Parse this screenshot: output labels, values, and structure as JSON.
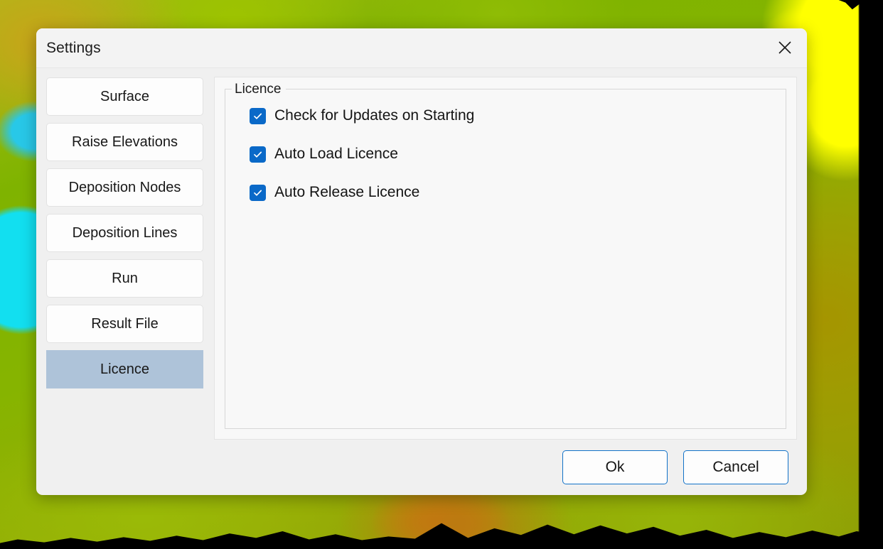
{
  "dialog": {
    "title": "Settings",
    "close_icon": "close-icon"
  },
  "sidebar": {
    "items": [
      {
        "label": "Surface",
        "selected": false
      },
      {
        "label": "Raise Elevations",
        "selected": false
      },
      {
        "label": "Deposition Nodes",
        "selected": false
      },
      {
        "label": "Deposition Lines",
        "selected": false
      },
      {
        "label": "Run",
        "selected": false
      },
      {
        "label": "Result File",
        "selected": false
      },
      {
        "label": "Licence",
        "selected": true
      }
    ]
  },
  "content": {
    "group_title": "Licence",
    "checkboxes": [
      {
        "label": "Check for Updates on Starting",
        "checked": true
      },
      {
        "label": "Auto Load Licence",
        "checked": true
      },
      {
        "label": "Auto Release Licence",
        "checked": true
      }
    ]
  },
  "footer": {
    "ok_label": "Ok",
    "cancel_label": "Cancel"
  },
  "colors": {
    "accent": "#0a69c8",
    "button_border": "#1272c8",
    "selected_nav": "#aec3d9",
    "dialog_bg": "#f0f0f0",
    "titlebar_bg": "#f3f3f3",
    "panel_bg": "#f8f8f8"
  },
  "background": {
    "description": "terrain-elevation-map"
  }
}
